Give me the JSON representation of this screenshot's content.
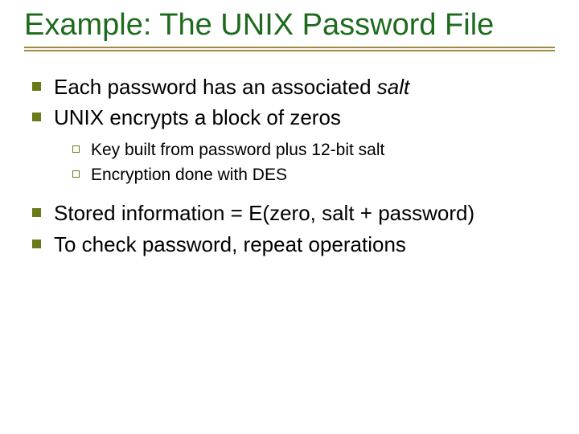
{
  "title": "Example:  The UNIX Password File",
  "bullets": {
    "b1_pre": "Each password has an associated ",
    "b1_em": "salt",
    "b2": "UNIX encrypts a block of zeros",
    "sub1": "Key built from password plus 12-bit salt",
    "sub2": "Encryption done with DES",
    "b3": "Stored information = E(zero, salt + password)",
    "b4": "To check password, repeat operations"
  }
}
